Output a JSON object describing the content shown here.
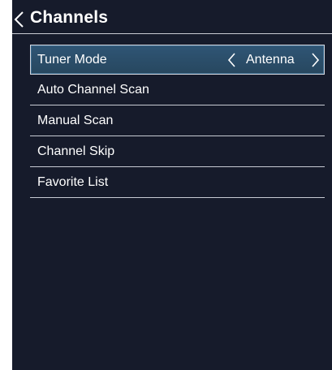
{
  "header": {
    "back_icon": "chevron-left-icon",
    "title": "Channels"
  },
  "colors": {
    "panel_background": "#161b2b",
    "selected_background": "#2f5575",
    "divider": "#c7cbd3",
    "text": "#ffffff"
  },
  "menu": {
    "items": [
      {
        "label": "Tuner Mode",
        "value": "Antenna",
        "selected": true
      },
      {
        "label": "Auto Channel Scan"
      },
      {
        "label": "Manual Scan"
      },
      {
        "label": "Channel Skip"
      },
      {
        "label": "Favorite List"
      }
    ],
    "value_left_icon": "chevron-left-icon",
    "value_right_icon": "chevron-right-icon"
  }
}
